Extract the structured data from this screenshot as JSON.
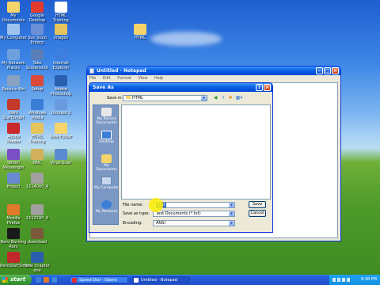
{
  "desktop_icons": [
    {
      "label": "My Documents",
      "color": "#f5d46a"
    },
    {
      "label": "Google Desktop",
      "color": "#e33b2e"
    },
    {
      "label": "HTML Training",
      "color": "#ffffff"
    },
    {
      "label": "My Computer",
      "color": "#9fc3ef"
    },
    {
      "label": "Sun Stuio Enterp",
      "color": "#6b8fd6"
    },
    {
      "label": "images",
      "color": "#e6c35c"
    },
    {
      "label": "HTML",
      "color": "#f5d46a"
    },
    {
      "label": "My Network Places",
      "color": "#6fa0de"
    },
    {
      "label": "Take Screenshot",
      "color": "#5a7fb8"
    },
    {
      "label": "Internet Explorer",
      "color": "#3d7fe0"
    },
    {
      "label": "Recycle Bin",
      "color": "#8aa2c0"
    },
    {
      "label": "Setup",
      "color": "#d94a3a"
    },
    {
      "label": "Adobe Photoshop",
      "color": "#2a5fb0"
    },
    {
      "label": "Nero StartSmart",
      "color": "#c33a2a"
    },
    {
      "label": "Windows Media",
      "color": "#3a7ed8"
    },
    {
      "label": "Untitled 3",
      "color": "#6a9ae0"
    },
    {
      "label": "Adobe Reader",
      "color": "#cc2a2a"
    },
    {
      "label": "HTML Training",
      "color": "#e6c35c"
    },
    {
      "label": "New Folder",
      "color": "#f5d46a"
    },
    {
      "label": "Yahoo! Messenger",
      "color": "#7a4fc4"
    },
    {
      "label": "NNC",
      "color": "#d0b05a"
    },
    {
      "label": "Virus-Scan",
      "color": "#5a8ad0"
    },
    {
      "label": "Project",
      "color": "#6a8ad0"
    },
    {
      "label": "1114000_4",
      "color": "#a0a0a0"
    },
    {
      "label": "Mozilla Firefox",
      "color": "#e07a2a"
    },
    {
      "label": "1112740_4",
      "color": "#a0a0a0"
    },
    {
      "label": "Nero Burning Rom",
      "color": "#1a1a1a"
    },
    {
      "label": "download",
      "color": "#7a5a3a"
    },
    {
      "label": "NeroStartSmart",
      "color": "#c0282a"
    },
    {
      "label": "final chapter one",
      "color": "#2a5fb0"
    }
  ],
  "notepad": {
    "title": "Untitled - Notepad",
    "menu": [
      "File",
      "Edit",
      "Format",
      "View",
      "Help"
    ]
  },
  "dialog": {
    "title": "Save As",
    "save_in_label": "Save in:",
    "save_in_value": "HTML",
    "places": [
      "My Recent Documents",
      "Desktop",
      "My Documents",
      "My Computer",
      "My Network"
    ],
    "file_name_label": "File name:",
    "file_name_value": "*.txt",
    "save_as_type_label": "Save as type:",
    "save_as_type_value": "Text Documents (*.txt)",
    "encoding_label": "Encoding:",
    "encoding_value": "ANSI",
    "save_button": "Save",
    "cancel_button": "Cancel"
  },
  "taskbar": {
    "start_label": "start",
    "tasks": [
      "Speed Dial - Opera",
      "Untitled - Notepad"
    ],
    "clock": "9:38 PM"
  }
}
